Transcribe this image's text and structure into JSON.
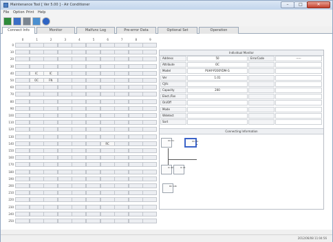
{
  "window": {
    "title": "Maintenance Tool [ Ver 5.00 ] - Air Conditioner",
    "controls": {
      "minimize": "–",
      "maximize": "□",
      "close": "✕"
    }
  },
  "menu": {
    "items": [
      "File",
      "Option",
      "Print",
      "Help"
    ]
  },
  "toolbar": {
    "buttons": [
      {
        "icon": "connect-icon",
        "color": "#2e8b3a"
      },
      {
        "icon": "save-icon",
        "color": "#3b6fc6"
      },
      {
        "icon": "print-icon",
        "color": "#7a8591"
      },
      {
        "icon": "monitor-icon",
        "color": "#4a8fd0"
      },
      {
        "icon": "help-icon",
        "color": "#2e64c4"
      }
    ]
  },
  "tabs": [
    {
      "label": "Connect Info",
      "active": true
    },
    {
      "label": "Monitor",
      "active": false
    },
    {
      "label": "Malfunc Log",
      "active": false
    },
    {
      "label": "Pre-error Data",
      "active": false
    },
    {
      "label": "Optional Set",
      "active": false
    },
    {
      "label": "Operation",
      "active": false
    }
  ],
  "grid": {
    "columns": [
      "0",
      "1",
      "2",
      "3",
      "4",
      "5",
      "6",
      "7",
      "8",
      "9"
    ],
    "rows": [
      "0",
      "10",
      "20",
      "30",
      "40",
      "50",
      "60",
      "70",
      "80",
      "90",
      "100",
      "110",
      "120",
      "130",
      "140",
      "150",
      "160",
      "170",
      "180",
      "190",
      "200",
      "210",
      "220",
      "230",
      "240",
      "250"
    ],
    "cells": [
      {
        "row": 4,
        "col": 1,
        "text": "IC"
      },
      {
        "row": 4,
        "col": 2,
        "text": "IC"
      },
      {
        "row": 5,
        "col": 1,
        "text": "OC"
      },
      {
        "row": 5,
        "col": 2,
        "text": "FN"
      },
      {
        "row": 14,
        "col": 6,
        "text": "RC"
      }
    ]
  },
  "individual_monitor": {
    "header": "Individual Monitor",
    "rows": [
      {
        "label": "Address",
        "value": "50",
        "label2": "ErrorCode",
        "value2": "-----"
      },
      {
        "label": "Attribute",
        "value": "OC",
        "label2": "",
        "value2": ""
      },
      {
        "label": "Model",
        "value": "PUHY-P200YDM-G",
        "label2": "",
        "value2": ""
      },
      {
        "label": "Ver",
        "value": "1.01",
        "label2": "",
        "value2": ""
      },
      {
        "label": "CJ/Ic",
        "value": "",
        "label2": "",
        "value2": ""
      },
      {
        "label": "Capacity",
        "value": "200",
        "label2": "",
        "value2": ""
      },
      {
        "label": "Elect./Fan",
        "value": "",
        "label2": "",
        "value2": ""
      },
      {
        "label": "On/Off",
        "value": "",
        "label2": "",
        "value2": ""
      },
      {
        "label": "Mode",
        "value": "",
        "label2": "",
        "value2": ""
      },
      {
        "label": "Wdetect",
        "value": "",
        "label2": "",
        "value2": ""
      },
      {
        "label": "Sort",
        "value": "",
        "label2": "",
        "value2": ""
      }
    ]
  },
  "connecting_information": {
    "header": "Connecting Information",
    "nodes": [
      {
        "label": "OC\n51",
        "selected": false
      },
      {
        "label": "OC\n50",
        "selected": true
      },
      {
        "label": "IC\n40",
        "selected": false
      },
      {
        "label": "IC\n41",
        "selected": false
      },
      {
        "label": "RC\n146",
        "selected": false
      }
    ]
  },
  "status": {
    "time": "2012/06/08 11:04:56"
  }
}
